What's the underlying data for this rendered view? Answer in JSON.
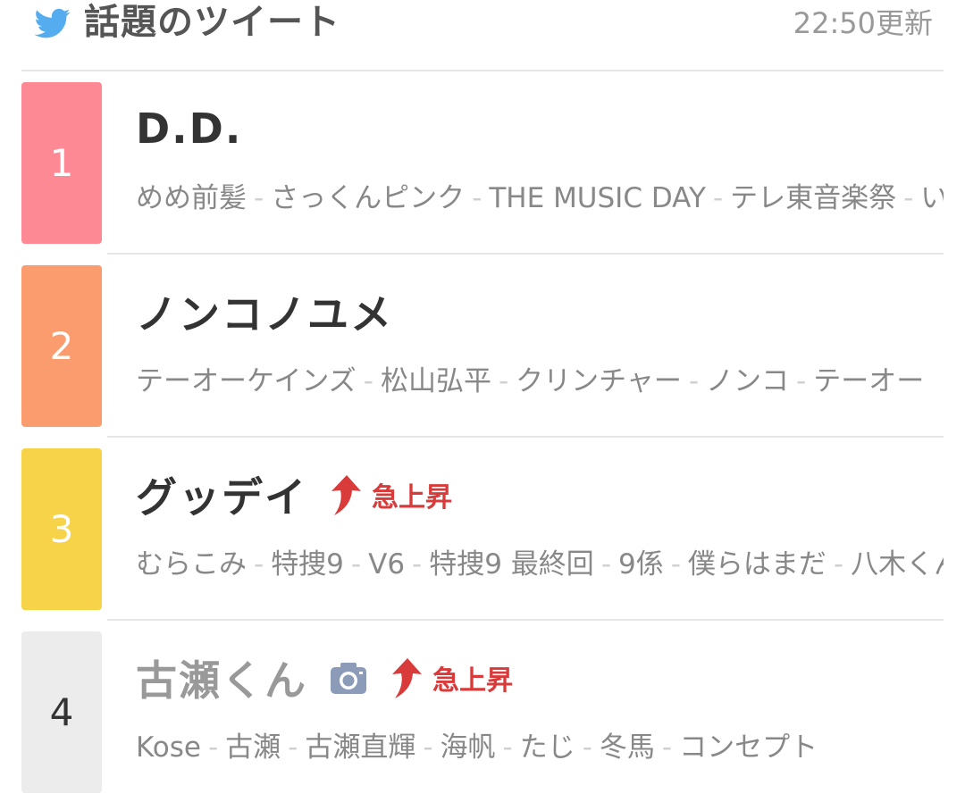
{
  "header": {
    "title": "話題のツイート",
    "updated": "22:50更新",
    "icon": "twitter-bird-icon",
    "icon_color": "#55acee"
  },
  "surge_color": "#d93b3b",
  "items": [
    {
      "rank": "1",
      "topic": "D.D.",
      "related": [
        "めめ前髪",
        "さっくんピンク",
        "THE MUSIC DAY",
        "テレ東音楽祭",
        "い"
      ],
      "surge": "",
      "camera": false,
      "rank_color": "#fc8993"
    },
    {
      "rank": "2",
      "topic": "ノンコノユメ",
      "related": [
        "テーオーケインズ",
        "松山弘平",
        "クリンチャー",
        "ノンコ",
        "テーオー"
      ],
      "surge": "",
      "camera": false,
      "rank_color": "#fb9c6f"
    },
    {
      "rank": "3",
      "topic": "グッデイ",
      "related": [
        "むらこみ",
        "特捜9",
        "V6",
        "特捜9 最終回",
        "9係",
        "僕らはまだ",
        "八木くん"
      ],
      "surge": "急上昇",
      "camera": false,
      "rank_color": "#f7d34a"
    },
    {
      "rank": "4",
      "topic": "古瀬くん",
      "related": [
        "Kose",
        "古瀬",
        "古瀬直輝",
        "海帆",
        "たじ",
        "冬馬",
        "コンセプト"
      ],
      "surge": "急上昇",
      "camera": true,
      "rank_color": "#ececec"
    }
  ]
}
